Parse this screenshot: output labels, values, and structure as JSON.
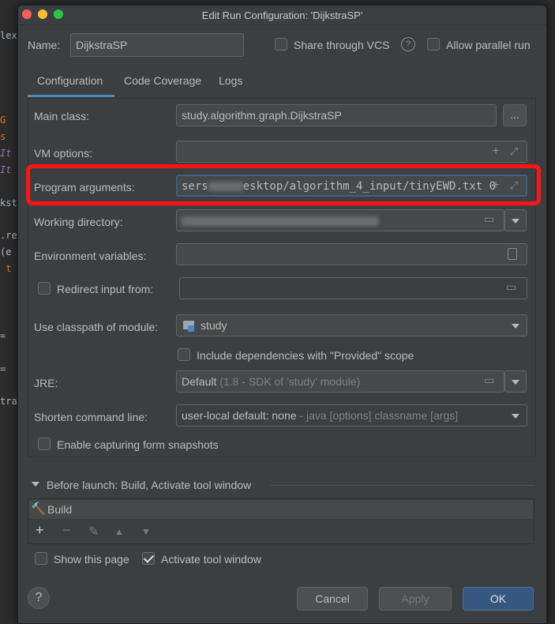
{
  "window": {
    "title": "Edit Run Configuration: 'DijkstraSP'"
  },
  "name": {
    "label": "Name:",
    "value": "DijkstraSP"
  },
  "share_vcs": {
    "label": "Share through VCS",
    "checked": false
  },
  "allow_parallel": {
    "label": "Allow parallel run",
    "checked": false
  },
  "tabs": [
    {
      "label": "Configuration",
      "active": true
    },
    {
      "label": "Code Coverage",
      "active": false
    },
    {
      "label": "Logs",
      "active": false
    }
  ],
  "main_class": {
    "label": "Main class:",
    "value": "study.algorithm.graph.DijkstraSP",
    "browse": "..."
  },
  "vm_options": {
    "label": "VM options:",
    "value": ""
  },
  "program_args": {
    "label": "Program arguments:",
    "value_prefix": "sers",
    "value_suffix": "esktop/algorithm_4_input/tinyEWD.txt 0"
  },
  "working_dir": {
    "label": "Working directory:"
  },
  "env_vars": {
    "label": "Environment variables:"
  },
  "redirect_input": {
    "label": "Redirect input from:",
    "checked": false
  },
  "classpath": {
    "label": "Use classpath of module:",
    "value": "study"
  },
  "include_deps": {
    "label": "Include dependencies with \"Provided\" scope",
    "checked": false
  },
  "jre": {
    "label": "JRE:",
    "value": "Default",
    "hint": " (1.8 - SDK of 'study' module)"
  },
  "shorten_cmd": {
    "label": "Shorten command line:",
    "value": "user-local default: none",
    "hint": " - java [options] classname [args]"
  },
  "form_snapshots": {
    "label": "Enable capturing form snapshots",
    "checked": false
  },
  "before_launch": {
    "label": "Before launch: Build, Activate tool window",
    "item": "Build"
  },
  "show_page": {
    "label": "Show this page",
    "checked": false
  },
  "activate_tool": {
    "label": "Activate tool window",
    "checked": true
  },
  "buttons": {
    "help": "?",
    "cancel": "Cancel",
    "apply": "Apply",
    "ok": "OK"
  },
  "colors": {
    "dialog_bg": "#3c3f41",
    "accent": "#365880",
    "highlight": "#ff1414"
  }
}
